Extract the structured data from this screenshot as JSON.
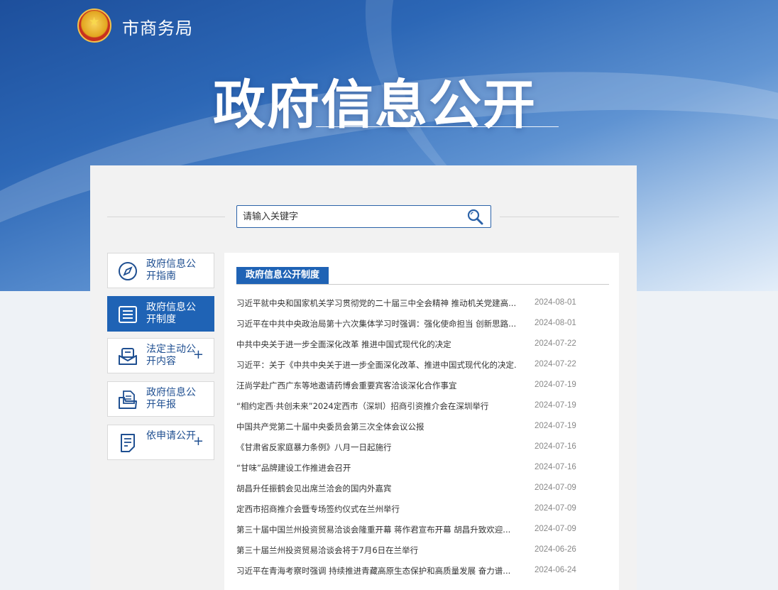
{
  "header": {
    "agency_name": "市商务局",
    "page_heading": "政府信息公开"
  },
  "search": {
    "placeholder": "请输入关键字"
  },
  "side_nav": [
    {
      "label": "政府信息公开指南",
      "icon": "compass-icon",
      "active": false,
      "expandable": false
    },
    {
      "label": "政府信息公开制度",
      "icon": "list-icon",
      "active": true,
      "expandable": false
    },
    {
      "label": "法定主动公开内容",
      "icon": "inbox-icon",
      "active": false,
      "expandable": true
    },
    {
      "label": "政府信息公开年报",
      "icon": "folder-icon",
      "active": false,
      "expandable": false
    },
    {
      "label": "依申请公开",
      "icon": "document-edit-icon",
      "active": false,
      "expandable": true
    }
  ],
  "content": {
    "section_title": "政府信息公开制度",
    "items": [
      {
        "title": "习近平就中央和国家机关学习贯彻党的二十届三中全会精神 推动机关党建高...",
        "date": "2024-08-01"
      },
      {
        "title": "习近平在中共中央政治局第十六次集体学习时强调：强化使命担当 创新思路...",
        "date": "2024-08-01"
      },
      {
        "title": "中共中央关于进一步全面深化改革 推进中国式现代化的决定",
        "date": "2024-07-22"
      },
      {
        "title": "习近平：关于《中共中央关于进一步全面深化改革、推进中国式现代化的决定...",
        "date": "2024-07-22"
      },
      {
        "title": "汪尚学赴广西广东等地邀请药博会重要宾客洽谈深化合作事宜",
        "date": "2024-07-19"
      },
      {
        "title": "“相约定西·共创未来”2024定西市（深圳）招商引资推介会在深圳举行",
        "date": "2024-07-19"
      },
      {
        "title": "中国共产党第二十届中央委员会第三次全体会议公报",
        "date": "2024-07-19"
      },
      {
        "title": "《甘肃省反家庭暴力条例》八月一日起施行",
        "date": "2024-07-16"
      },
      {
        "title": "“甘味”品牌建设工作推进会召开",
        "date": "2024-07-16"
      },
      {
        "title": "胡昌升任振鹤会见出席兰洽会的国内外嘉宾",
        "date": "2024-07-09"
      },
      {
        "title": "定西市招商推介会暨专场签约仪式在兰州举行",
        "date": "2024-07-09"
      },
      {
        "title": "第三十届中国兰州投资贸易洽谈会隆重开幕 蒋作君宣布开幕 胡昌升致欢迎...",
        "date": "2024-07-09"
      },
      {
        "title": "第三十届兰州投资贸易洽谈会将于7月6日在兰举行",
        "date": "2024-06-26"
      },
      {
        "title": "习近平在青海考察时强调 持续推进青藏高原生态保护和高质量发展 奋力谱...",
        "date": "2024-06-24"
      }
    ]
  },
  "colors": {
    "primary": "#1f63b5",
    "nav_text": "#1f4f91",
    "date_text": "#888888"
  }
}
